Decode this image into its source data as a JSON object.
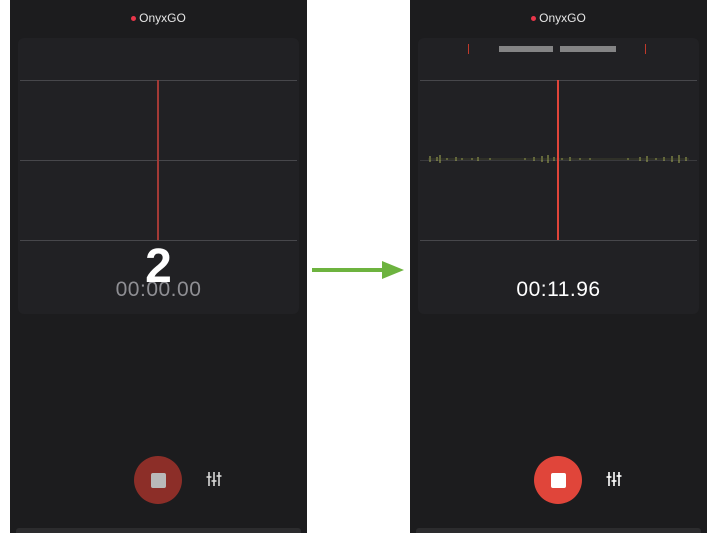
{
  "colors": {
    "phone_bg": "#1c1c1e",
    "panel_bg": "#212124",
    "grid_line": "#47474b",
    "recording_dot": "#e8364a",
    "playhead_idle": "#a33a36",
    "playhead_active": "#e0453a",
    "record_button_idle": "#8c2e28",
    "record_button_active": "#e0453a",
    "stop_square_idle": "#b9b9b9",
    "stop_square_active": "#ffffff",
    "timer_idle": "#8e8e93",
    "timer_active": "#ffffff",
    "waveform": "#a5ad52",
    "arrow": "#6db33f"
  },
  "left_screen": {
    "app_title": "OnyxGO",
    "countdown": "2",
    "timer": "00:00.00",
    "record_button_icon": "stop-icon",
    "settings_icon": "equalizer-icon"
  },
  "right_screen": {
    "app_title": "OnyxGO",
    "timer": "00:11.96",
    "record_button_icon": "stop-icon",
    "settings_icon": "equalizer-icon"
  },
  "transition_icon": "right-arrow-icon"
}
